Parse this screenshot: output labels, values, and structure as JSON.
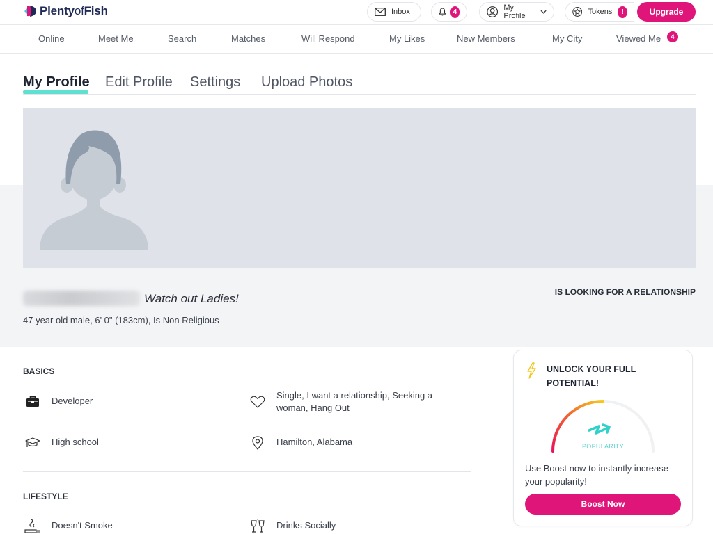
{
  "brand": {
    "name_bold": "Plenty",
    "name_light": "of",
    "name_end": "Fish",
    "accent": "#e0157a",
    "teal": "#5fe1d2"
  },
  "header": {
    "inbox_label": "Inbox",
    "notifications_count": "4",
    "profile_label": "My Profile",
    "tokens_label": "Tokens",
    "tokens_badge": "!",
    "upgrade_label": "Upgrade"
  },
  "nav": {
    "items": [
      {
        "label": "Online"
      },
      {
        "label": "Meet Me"
      },
      {
        "label": "Search"
      },
      {
        "label": "Matches"
      },
      {
        "label": "Will Respond"
      },
      {
        "label": "My Likes"
      },
      {
        "label": "New Members"
      },
      {
        "label": "My City"
      },
      {
        "label": "Viewed Me",
        "badge": "4"
      }
    ]
  },
  "tabs": [
    {
      "label": "My Profile",
      "active": true
    },
    {
      "label": "Edit Profile"
    },
    {
      "label": "Settings"
    },
    {
      "label": "Upload Photos"
    }
  ],
  "profile": {
    "tagline": "Watch out Ladies!",
    "details": "47 year old male, 6' 0\" (183cm), Is Non Religious",
    "looking_for": "IS LOOKING FOR A RELATIONSHIP"
  },
  "basics": {
    "title": "BASICS",
    "items": [
      {
        "icon": "briefcase-icon",
        "text": "Developer"
      },
      {
        "icon": "heart-icon",
        "text": "Single, I want a relationship, Seeking a woman, Hang Out"
      },
      {
        "icon": "graduation-cap-icon",
        "text": "High school"
      },
      {
        "icon": "location-pin-icon",
        "text": "Hamilton, Alabama"
      }
    ]
  },
  "lifestyle": {
    "title": "LIFESTYLE",
    "items": [
      {
        "icon": "cigarette-icon",
        "text": "Doesn't Smoke"
      },
      {
        "icon": "wine-glasses-icon",
        "text": "Drinks Socially"
      }
    ]
  },
  "boost_card": {
    "title": "UNLOCK YOUR FULL POTENTIAL!",
    "gauge_label": "POPULARITY",
    "gauge_level_fraction": 0.5,
    "text": "Use Boost now to instantly increase your popularity!",
    "button_label": "Boost Now"
  }
}
